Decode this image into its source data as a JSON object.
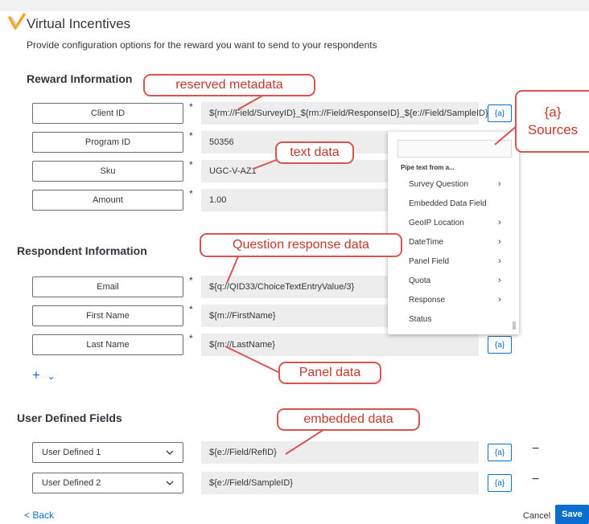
{
  "app": {
    "title": "Virtual Incentives",
    "description": "Provide configuration options for the reward you want to send to your respondents"
  },
  "sections": {
    "reward": "Reward Information",
    "respondent": "Respondent Information",
    "user_defined": "User Defined Fields"
  },
  "reward_fields": [
    {
      "label": "Client ID",
      "required": "*",
      "value": "${rm://Field/SurveyID}_${rm://Field/ResponseID}_${e://Field/SampleID}"
    },
    {
      "label": "Program ID",
      "required": "*",
      "value": "50356"
    },
    {
      "label": "Sku",
      "required": "*",
      "value": "UGC-V-AZ1"
    },
    {
      "label": "Amount",
      "required": "*",
      "value": "1.00"
    }
  ],
  "respondent_fields": [
    {
      "label": "Email",
      "required": "*",
      "value": "${q://QID33/ChoiceTextEntryValue/3}"
    },
    {
      "label": "First Name",
      "required": "*",
      "value": "${m://FirstName}"
    },
    {
      "label": "Last Name",
      "required": "*",
      "value": "${m://LastName}"
    }
  ],
  "user_defined_fields": [
    {
      "label": "User Defined 1",
      "value": "${e://Field/RefID}"
    },
    {
      "label": "User Defined 2",
      "value": "${e://Field/SampleID}"
    }
  ],
  "pipe_button": "{a}",
  "remove_symbol": "−",
  "add_row": {
    "plus": "+",
    "chevron": "⌄"
  },
  "dropdown_menu": {
    "header": "Pipe text from a...",
    "items": [
      {
        "label": "Survey Question",
        "arrow": "›"
      },
      {
        "label": "Embedded Data Field",
        "arrow": ""
      },
      {
        "label": "GeoIP Location",
        "arrow": "›"
      },
      {
        "label": "DateTime",
        "arrow": "›"
      },
      {
        "label": "Panel Field",
        "arrow": "›"
      },
      {
        "label": "Quota",
        "arrow": "›"
      },
      {
        "label": "Response",
        "arrow": "›"
      },
      {
        "label": "Status",
        "arrow": ""
      }
    ]
  },
  "callouts": {
    "reserved": "reserved metadata",
    "text": "text data",
    "question": "Question response data",
    "panel": "Panel data",
    "embedded": "embedded data",
    "sources_line1": "{a}",
    "sources_line2": "Sources"
  },
  "footer": {
    "back": "< Back",
    "cancel": "Cancel",
    "save": "Save"
  },
  "colors": {
    "accent": "#0a6ed1",
    "callout": "#d9534f"
  }
}
